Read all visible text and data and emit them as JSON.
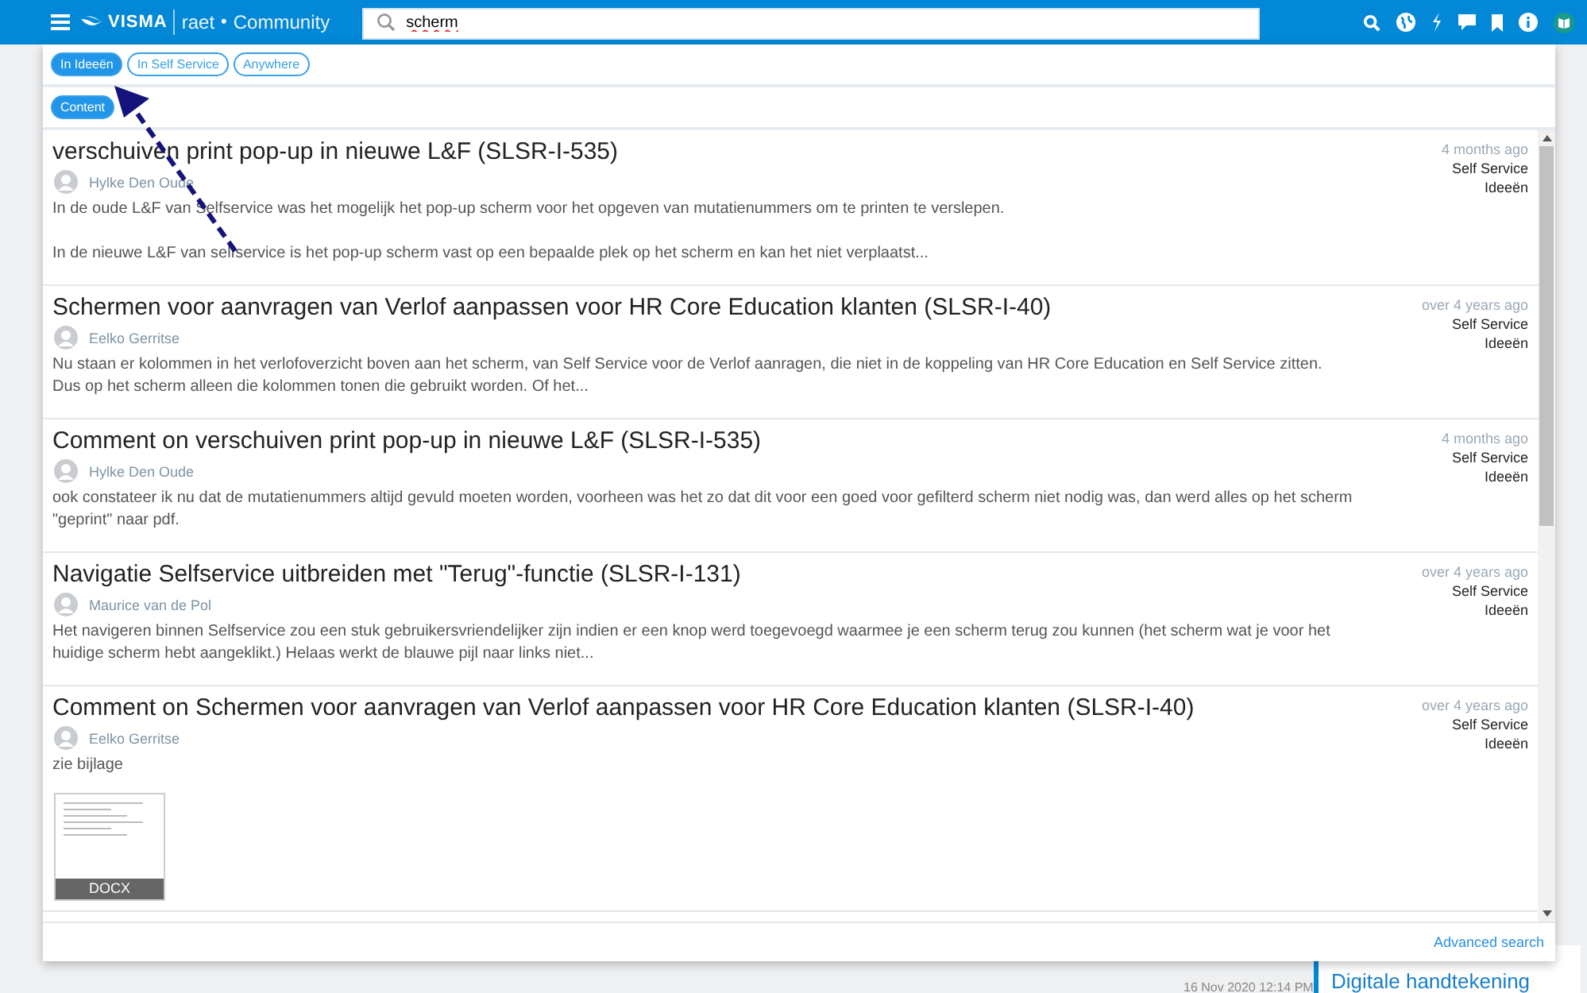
{
  "header": {
    "logo": "VISMA",
    "brand": "raet",
    "separator": "•",
    "community": "Community",
    "search": {
      "value": "scherm"
    }
  },
  "filters": [
    {
      "label": "In Ideeën",
      "selected": true
    },
    {
      "label": "In Self Service",
      "selected": false
    },
    {
      "label": "Anywhere",
      "selected": false
    }
  ],
  "content_filter": {
    "label": "Content",
    "selected": true
  },
  "results": [
    {
      "title": "verschuiven print pop-up in nieuwe L&F (SLSR-I-535)",
      "author": "Hylke Den Oude",
      "body": [
        "In de oude L&F van Selfservice was het mogelijk het pop-up scherm voor het opgeven van mutatienummers om te printen te verslepen.",
        "In de nieuwe L&F van selfservice is het pop-up scherm vast op een bepaalde plek op het scherm en kan het niet verplaatst..."
      ],
      "time": "4 months ago",
      "place": "Self Service",
      "category": "Ideeën"
    },
    {
      "title": "Schermen voor aanvragen van Verlof aanpassen voor HR Core Education klanten (SLSR-I-40)",
      "author": "Eelko Gerritse",
      "body": [
        "Nu staan er kolommen in het verlofoverzicht boven aan het scherm, van Self Service voor de Verlof aanragen, die niet in de koppeling van HR Core Education en Self Service zitten. Dus op het scherm alleen die kolommen tonen die gebruikt worden. Of het..."
      ],
      "time": "over 4 years ago",
      "place": "Self Service",
      "category": "Ideeën"
    },
    {
      "title": "Comment on verschuiven print pop-up in nieuwe L&F (SLSR-I-535)",
      "author": "Hylke Den Oude",
      "body": [
        "ook constateer ik nu dat de mutatienummers altijd gevuld moeten worden, voorheen was het zo dat dit voor een goed voor gefilterd scherm niet nodig was, dan werd alles op het scherm \"geprint\" naar pdf."
      ],
      "time": "4 months ago",
      "place": "Self Service",
      "category": "Ideeën"
    },
    {
      "title": "Navigatie Selfservice uitbreiden met \"Terug\"-functie (SLSR-I-131)",
      "author": "Maurice van de Pol",
      "body": [
        "Het navigeren binnen Selfservice zou een stuk gebruikersvriendelijker zijn indien er een knop werd toegevoegd waarmee je een scherm terug zou kunnen (het scherm wat je voor het huidige scherm hebt aangeklikt.) Helaas werkt de blauwe pijl naar links niet..."
      ],
      "time": "over 4 years ago",
      "place": "Self Service",
      "category": "Ideeën"
    },
    {
      "title": "Comment on Schermen voor aanvragen van Verlof aanpassen voor HR Core Education klanten (SLSR-I-40)",
      "author": "Eelko Gerritse",
      "body": [
        "zie bijlage"
      ],
      "time": "over 4 years ago",
      "place": "Self Service",
      "category": "Ideeën",
      "attachment": {
        "type": "DOCX"
      }
    }
  ],
  "advanced_search": "Advanced search",
  "background": {
    "date": "16 Nov 2020 12:14 PM",
    "sidebar_link": "Digitale handtekening"
  }
}
